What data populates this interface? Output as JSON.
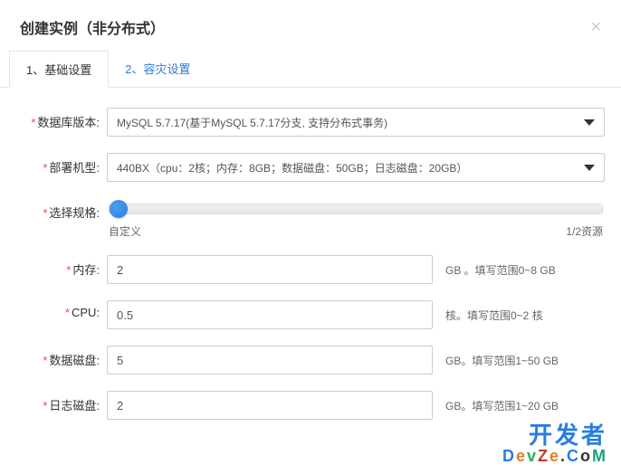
{
  "header": {
    "title": "创建实例（非分布式）"
  },
  "tabs": {
    "tab1": "1、基础设置",
    "tab2": "2、容灾设置"
  },
  "form": {
    "dbversion": {
      "label": "数据库版本:",
      "value": "MySQL 5.7.17(基于MySQL 5.7.17分支, 支持分布式事务)"
    },
    "machine": {
      "label": "部署机型:",
      "value": "440BX（cpu：2核；内存：8GB；数据磁盘：50GB；日志磁盘：20GB）"
    },
    "spec": {
      "label": "选择规格:",
      "left": "自定义",
      "right": "1/2资源"
    },
    "memory": {
      "label": "内存:",
      "value": "2",
      "hint": "GB 。填写范围0~8 GB"
    },
    "cpu": {
      "label": "CPU:",
      "value": "0.5",
      "hint": "核。填写范围0~2 核"
    },
    "datadisk": {
      "label": "数据磁盘:",
      "value": "5",
      "hint": "GB。填写范围1~50 GB"
    },
    "logdisk": {
      "label": "日志磁盘:",
      "value": "2",
      "hint": "GB。填写范围1~20 GB"
    }
  },
  "watermark": {
    "line1": "开发者"
  }
}
